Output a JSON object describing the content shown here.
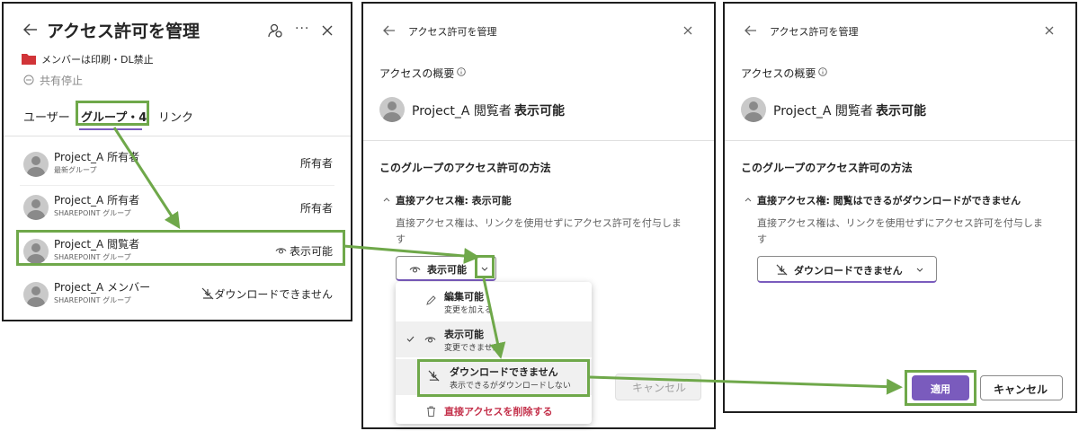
{
  "colors": {
    "accent": "#7a5bbd",
    "highlight": "#6fa84a",
    "danger": "#c4314b",
    "folder": "#d13438"
  },
  "panel1": {
    "title": "アクセス許可を管理",
    "label_line": "メンバーは印刷・DL禁止",
    "stop_sharing": "共有停止",
    "tabs": [
      "ユーザー",
      "グループ・4",
      "リンク"
    ],
    "rows": [
      {
        "name": "Project_A 所有者",
        "sub": "最新グループ",
        "perm": "所有者"
      },
      {
        "name": "Project_A 所有者",
        "sub": "SHAREPOINT グループ",
        "perm": "所有者"
      },
      {
        "name": "Project_A 閲覧者",
        "sub": "SHAREPOINT グループ",
        "perm": "表示可能"
      },
      {
        "name": "Project_A メンバー",
        "sub": "SHAREPOINT グループ",
        "perm": "ダウンロードできません"
      }
    ]
  },
  "panel2": {
    "title": "アクセス許可を管理",
    "overview": "アクセスの概要",
    "group_name": "Project_A 閲覧者",
    "group_perm": "表示可能",
    "section_title": "このグループのアクセス許可の方法",
    "direct_title": "直接アクセス権: 表示可能",
    "desc1": "直接アクセス権は、リンクを使用せずにアクセス許可を付与しま",
    "desc2": "す",
    "dropdown_value": "表示可能",
    "menu": [
      {
        "label": "編集可能",
        "sub": "変更を加える"
      },
      {
        "label": "表示可能",
        "sub": "変更できません"
      },
      {
        "label": "ダウンロードできません",
        "sub": "表示できるがダウンロードしない"
      }
    ],
    "remove_label": "直接アクセスを削除する",
    "cancel_label": "キャンセル"
  },
  "panel3": {
    "title": "アクセス許可を管理",
    "overview": "アクセスの概要",
    "group_name": "Project_A 閲覧者",
    "group_perm": "表示可能",
    "section_title": "このグループのアクセス許可の方法",
    "direct_title": "直接アクセス権: 閲覧はできるがダウンロードができません",
    "desc1": "直接アクセス権は、リンクを使用せずにアクセス許可を付与しま",
    "desc2": "す",
    "dropdown_value": "ダウンロードできません",
    "apply_label": "適用",
    "cancel_label": "キャンセル"
  }
}
